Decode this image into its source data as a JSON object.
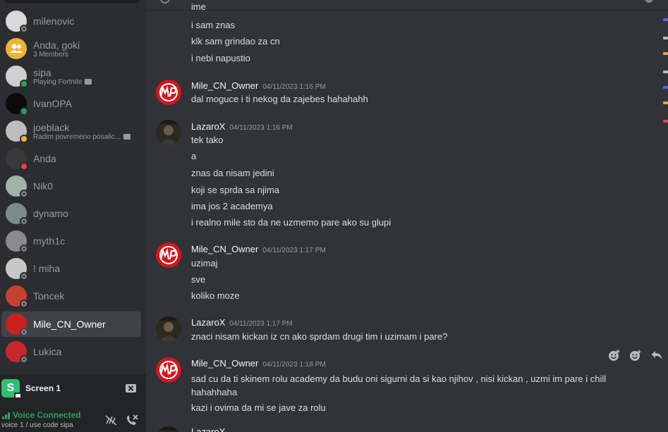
{
  "sidebar": {
    "dms": [
      {
        "name": "milenovic",
        "sub": "",
        "status": "offline",
        "avatar_color": "#d9d9d9",
        "active": false
      },
      {
        "name": "Anda, goki",
        "sub": "3 Members",
        "status": "",
        "avatar_color": "#f0b232",
        "active": false,
        "group": true
      },
      {
        "name": "sipa",
        "sub": "Playing Fortnite",
        "status": "online",
        "avatar_color": "#cfcfcf",
        "active": false,
        "rich": true
      },
      {
        "name": "IvanOPA",
        "sub": "",
        "status": "online",
        "avatar_color": "#0b0b0b",
        "active": false
      },
      {
        "name": "joeblack",
        "sub": "Radim povremeno posalic...",
        "status": "idle",
        "avatar_color": "#bdbdbd",
        "active": false,
        "rich": true
      },
      {
        "name": "Anda",
        "sub": "",
        "status": "dnd",
        "avatar_color": "#3a3a3a",
        "active": false
      },
      {
        "name": "Nik0",
        "sub": "",
        "status": "offline",
        "avatar_color": "#9fb3a6",
        "active": false
      },
      {
        "name": "dynamo",
        "sub": "",
        "status": "offline",
        "avatar_color": "#7c8a8a",
        "active": false
      },
      {
        "name": "myth1c",
        "sub": "",
        "status": "offline",
        "avatar_color": "#8a8a8a",
        "active": false
      },
      {
        "name": "! miha",
        "sub": "",
        "status": "offline",
        "avatar_color": "#c7c7c7",
        "active": false
      },
      {
        "name": "Toncek",
        "sub": "",
        "status": "offline",
        "avatar_color": "#c4412e",
        "active": false
      },
      {
        "name": "Mile_CN_Owner",
        "sub": "",
        "status": "offline",
        "avatar_color": "#cc1f1f",
        "active": true
      },
      {
        "name": "Lukica",
        "sub": "",
        "status": "offline",
        "avatar_color": "#c62828",
        "active": false
      }
    ],
    "screen_share": {
      "title": "Screen 1",
      "app_letter": "S"
    },
    "voice": {
      "status": "Voice Connected",
      "channel": "voice 1 / use code sipa"
    }
  },
  "chat": {
    "top_lines": [
      "ime",
      "i sam znas",
      "klk sam grindao za cn",
      "i nebi napustio"
    ],
    "messages": [
      {
        "author": "Mile_CN_Owner",
        "time": "04/11/2023 1:16 PM",
        "avatar": "mp",
        "lines": [
          "dal moguce i ti nekog da zajebes hahahahh"
        ]
      },
      {
        "author": "LazaroX",
        "time": "04/11/2023 1:16 PM",
        "avatar": "dark",
        "lines": [
          "tek tako",
          "a",
          "znas da nisam jedini",
          "koji se sprda sa njima",
          "ima jos 2 academya",
          "i realno mile sto da ne uzmemo pare ako su glupi"
        ]
      },
      {
        "author": "Mile_CN_Owner",
        "time": "04/11/2023 1:17 PM",
        "avatar": "mp",
        "lines": [
          "uzimaj",
          "sve",
          "koliko moze"
        ]
      },
      {
        "author": "LazaroX",
        "time": "04/11/2023 1:17 PM",
        "avatar": "dark",
        "lines": [
          "znaci nisam kickan iz cn ako sprdam drugi tim i uzimam i pare?"
        ]
      },
      {
        "author": "Mile_CN_Owner",
        "time": "04/11/2023 1:18 PM",
        "avatar": "mp",
        "lines": [
          "sad cu da ti skinem rolu academy da budu oni sigurni da si kao njihov , nisi kickan , uzmi im pare i chill hahahhaha",
          "kazi i ovima da mi se jave za rolu"
        ]
      }
    ],
    "next_author_partial": "LazaroX"
  },
  "icons": {
    "add_reaction": "add-reaction-icon",
    "super_reaction": "super-reaction-icon",
    "reply": "reply-icon",
    "noise_suppression": "noise-suppression-icon",
    "disconnect": "disconnect-icon"
  },
  "colors": {
    "accent_green": "#23a55a",
    "sidebar_bg": "#2b2d31",
    "chat_bg": "#313338",
    "mp_red": "#d4161c"
  }
}
